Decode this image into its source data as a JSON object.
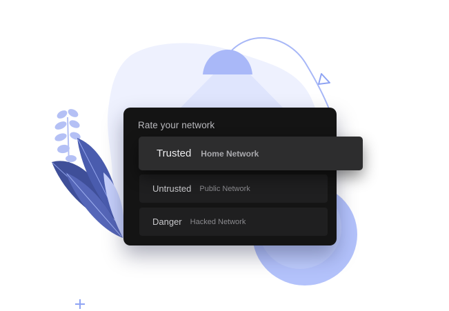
{
  "panel": {
    "title": "Rate your network"
  },
  "options": [
    {
      "label": "Trusted",
      "sublabel": "Home Network",
      "state": "selected"
    },
    {
      "label": "Untrusted",
      "sublabel": "Public Network",
      "state": "default"
    },
    {
      "label": "Danger",
      "sublabel": "Hacked Network",
      "state": "default"
    }
  ],
  "colors": {
    "panel_background": "#141414",
    "option_background": "#1f1f20",
    "selected_background": "#2d2d2e",
    "accent_blue": "#aab8f5",
    "leaf_navy": "#3f4f99"
  },
  "icons": {
    "lamp": "pendant-lamp-icon",
    "triangle": "triangle-outline-icon",
    "plus": "plus-icon",
    "leaves": "leaf-illustration",
    "sprig": "sprig-illustration"
  }
}
